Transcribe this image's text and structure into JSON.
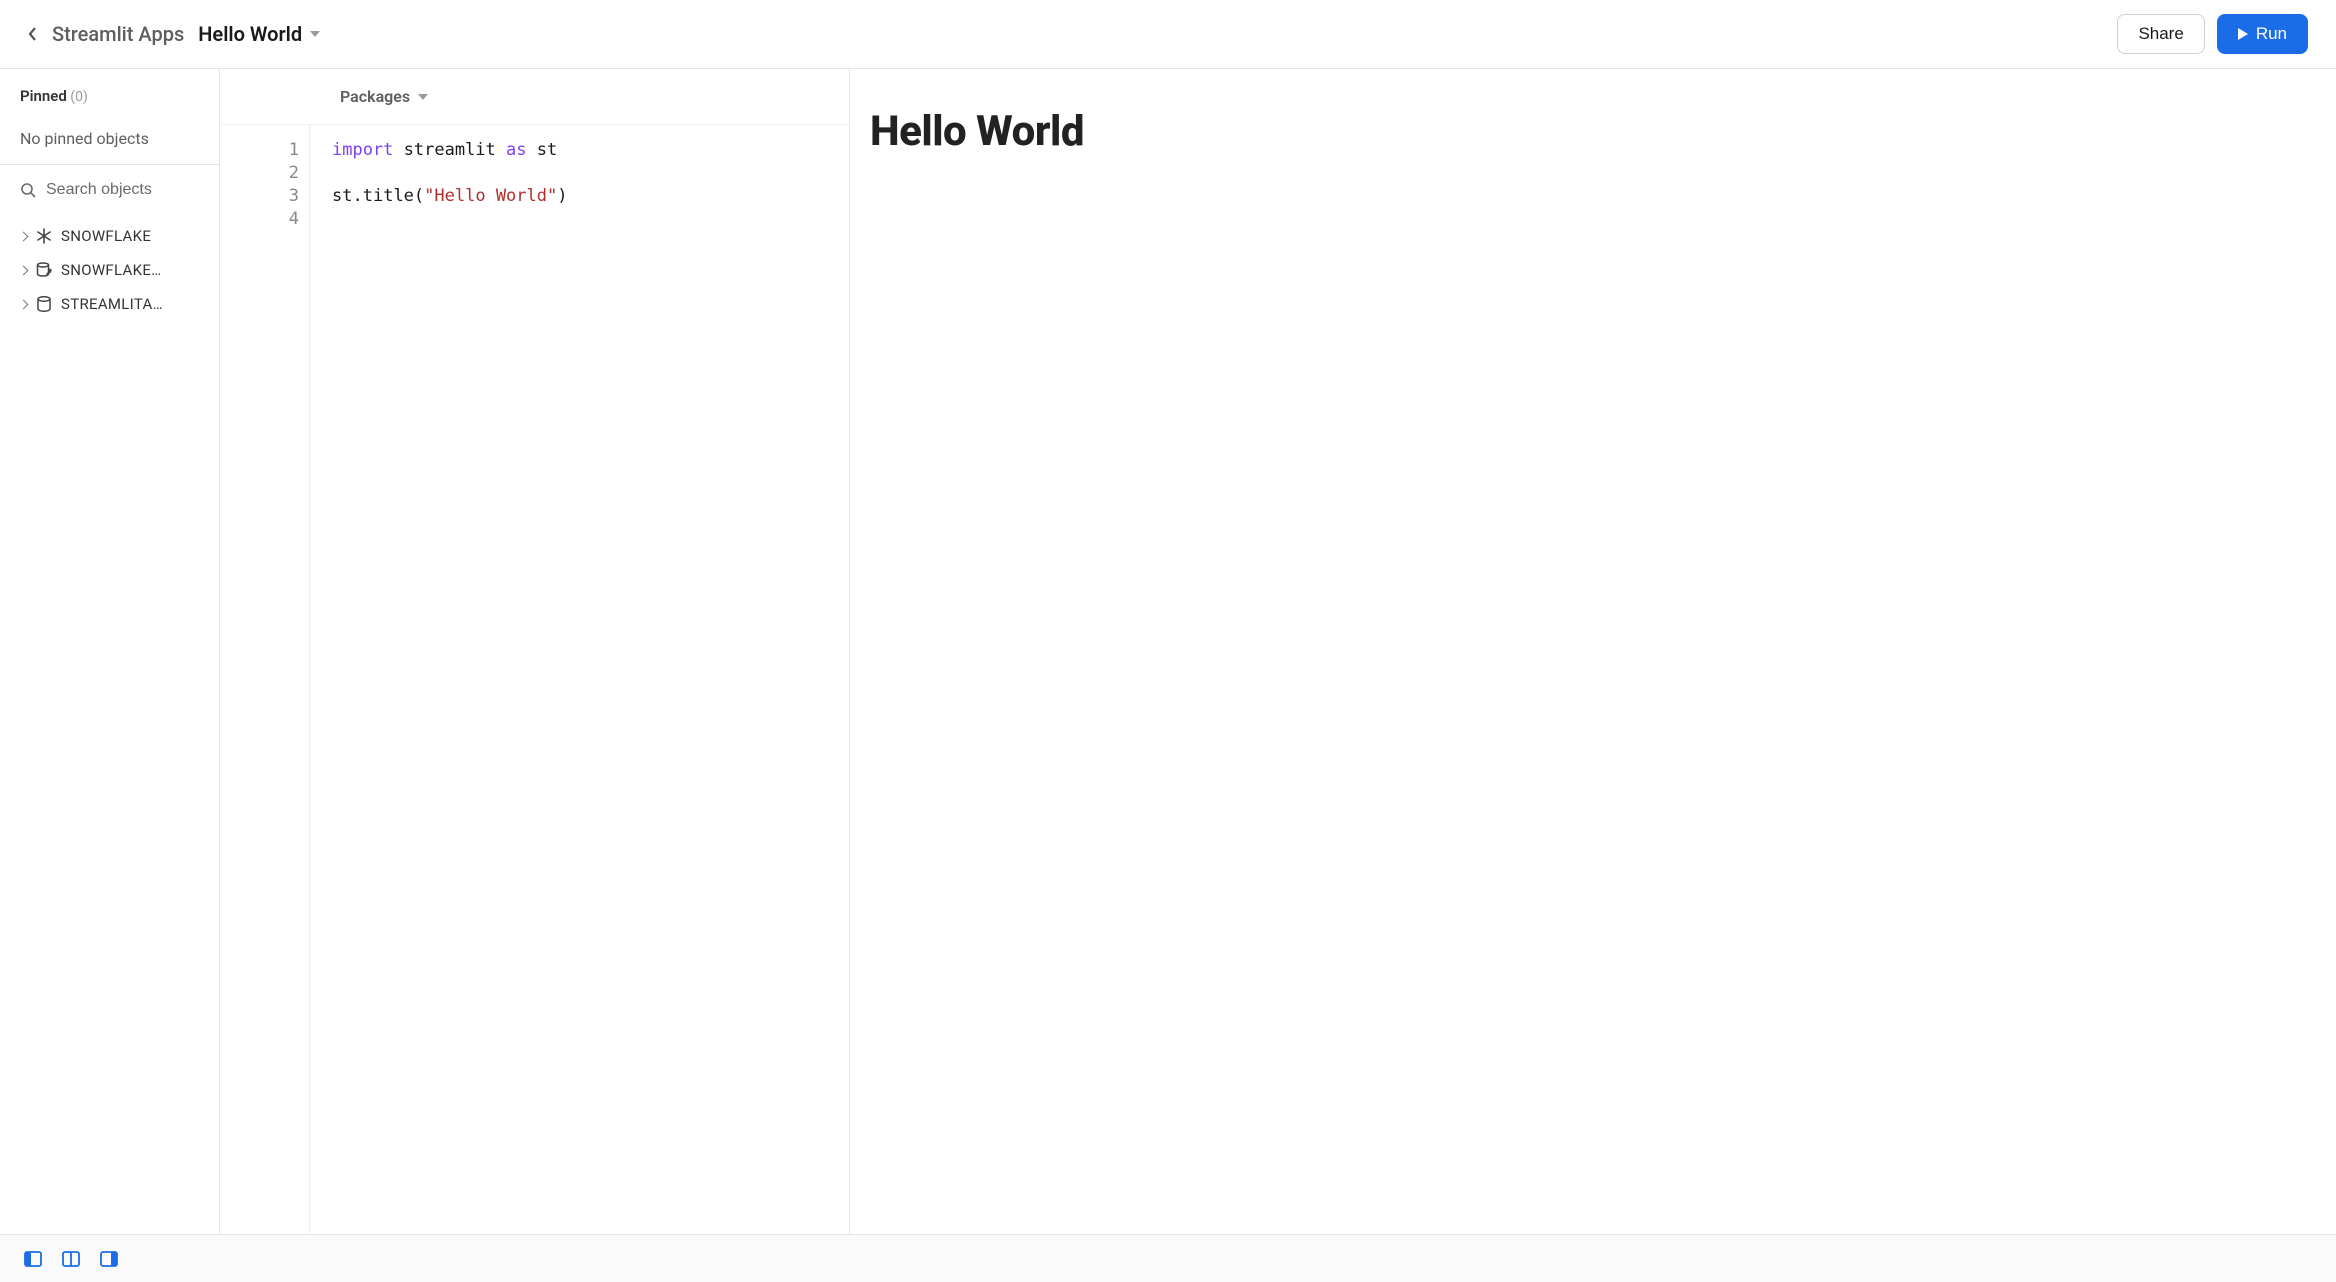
{
  "header": {
    "breadcrumb_parent": "Streamlit Apps",
    "breadcrumb_current": "Hello World",
    "share_label": "Share",
    "run_label": "Run"
  },
  "sidebar": {
    "pinned_label": "Pinned",
    "pinned_count": "(0)",
    "pinned_empty_text": "No pinned objects",
    "search_placeholder": "Search objects",
    "items": [
      {
        "label": "SNOWFLAKE",
        "icon": "snowflake"
      },
      {
        "label": "SNOWFLAKE…",
        "icon": "db-share"
      },
      {
        "label": "STREAMLITA…",
        "icon": "db"
      }
    ]
  },
  "editor": {
    "packages_label": "Packages",
    "line_numbers": [
      "1",
      "2",
      "3",
      "4"
    ],
    "code_tokens": [
      [
        {
          "t": "import",
          "c": "kw"
        },
        {
          "t": " streamlit ",
          "c": "id"
        },
        {
          "t": "as",
          "c": "kw"
        },
        {
          "t": " st",
          "c": "id"
        }
      ],
      [],
      [
        {
          "t": "st",
          "c": "id"
        },
        {
          "t": ".",
          "c": "punc"
        },
        {
          "t": "title",
          "c": "call"
        },
        {
          "t": "(",
          "c": "punc"
        },
        {
          "t": "\"Hello World\"",
          "c": "str"
        },
        {
          "t": ")",
          "c": "punc"
        }
      ],
      []
    ]
  },
  "preview": {
    "title": "Hello World"
  },
  "footer": {
    "layout_modes": [
      {
        "name": "layout-left",
        "active": true
      },
      {
        "name": "layout-split",
        "active": true
      },
      {
        "name": "layout-right",
        "active": true
      }
    ]
  }
}
